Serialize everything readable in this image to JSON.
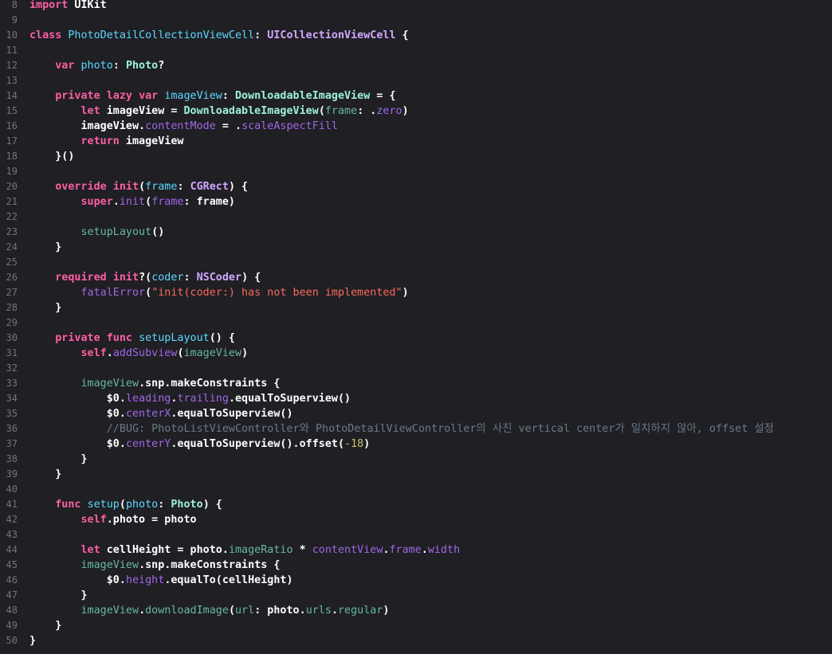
{
  "editor": {
    "language": "swift",
    "colors": {
      "background": "#1f1f24",
      "keyword": "#fc5fa3",
      "declaration": "#5dd8ff",
      "type": "#d0a8ff",
      "project_type": "#9ef1dd",
      "member": "#67b7a4",
      "other_property": "#a167e6",
      "string": "#fc6a5d",
      "number": "#d0bf69",
      "comment": "#6c7986",
      "line_number": "#747478"
    },
    "lines": [
      {
        "n": "8",
        "tokens": [
          {
            "t": "import",
            "c": "kw"
          },
          {
            "t": " UIKit",
            "c": "plain"
          }
        ]
      },
      {
        "n": "9",
        "tokens": []
      },
      {
        "n": "10",
        "tokens": [
          {
            "t": "class",
            "c": "kw"
          },
          {
            "t": " ",
            "c": "plain"
          },
          {
            "t": "PhotoDetailCollectionViewCell",
            "c": "decl"
          },
          {
            "t": ": ",
            "c": "plain"
          },
          {
            "t": "UICollectionViewCell",
            "c": "type"
          },
          {
            "t": " {",
            "c": "plain"
          }
        ]
      },
      {
        "n": "11",
        "tokens": []
      },
      {
        "n": "12",
        "tokens": [
          {
            "t": "    ",
            "c": "plain"
          },
          {
            "t": "var",
            "c": "kw"
          },
          {
            "t": " ",
            "c": "plain"
          },
          {
            "t": "photo",
            "c": "decl"
          },
          {
            "t": ": ",
            "c": "plain"
          },
          {
            "t": "Photo",
            "c": "tyof"
          },
          {
            "t": "?",
            "c": "plain"
          }
        ]
      },
      {
        "n": "13",
        "tokens": []
      },
      {
        "n": "14",
        "tokens": [
          {
            "t": "    ",
            "c": "plain"
          },
          {
            "t": "private",
            "c": "kw"
          },
          {
            "t": " ",
            "c": "plain"
          },
          {
            "t": "lazy",
            "c": "kw"
          },
          {
            "t": " ",
            "c": "plain"
          },
          {
            "t": "var",
            "c": "kw"
          },
          {
            "t": " ",
            "c": "plain"
          },
          {
            "t": "imageView",
            "c": "decl"
          },
          {
            "t": ": ",
            "c": "plain"
          },
          {
            "t": "DownloadableImageView",
            "c": "tyof"
          },
          {
            "t": " = {",
            "c": "plain"
          }
        ]
      },
      {
        "n": "15",
        "tokens": [
          {
            "t": "        ",
            "c": "plain"
          },
          {
            "t": "let",
            "c": "kw"
          },
          {
            "t": " imageView = ",
            "c": "plain"
          },
          {
            "t": "DownloadableImageView",
            "c": "tyof"
          },
          {
            "t": "(",
            "c": "plain"
          },
          {
            "t": "frame",
            "c": "memb"
          },
          {
            "t": ": .",
            "c": "plain"
          },
          {
            "t": "zero",
            "c": "prop"
          },
          {
            "t": ")",
            "c": "plain"
          }
        ]
      },
      {
        "n": "16",
        "tokens": [
          {
            "t": "        imageView.",
            "c": "plain"
          },
          {
            "t": "contentMode",
            "c": "prop"
          },
          {
            "t": " = .",
            "c": "plain"
          },
          {
            "t": "scaleAspectFill",
            "c": "prop"
          }
        ]
      },
      {
        "n": "17",
        "tokens": [
          {
            "t": "        ",
            "c": "plain"
          },
          {
            "t": "return",
            "c": "kw"
          },
          {
            "t": " imageView",
            "c": "plain"
          }
        ]
      },
      {
        "n": "18",
        "tokens": [
          {
            "t": "    }()",
            "c": "plain"
          }
        ]
      },
      {
        "n": "19",
        "tokens": []
      },
      {
        "n": "20",
        "tokens": [
          {
            "t": "    ",
            "c": "plain"
          },
          {
            "t": "override",
            "c": "kw"
          },
          {
            "t": " ",
            "c": "plain"
          },
          {
            "t": "init",
            "c": "kw"
          },
          {
            "t": "(",
            "c": "plain"
          },
          {
            "t": "frame",
            "c": "decl"
          },
          {
            "t": ": ",
            "c": "plain"
          },
          {
            "t": "CGRect",
            "c": "type"
          },
          {
            "t": ") {",
            "c": "plain"
          }
        ]
      },
      {
        "n": "21",
        "tokens": [
          {
            "t": "        ",
            "c": "plain"
          },
          {
            "t": "super",
            "c": "kw"
          },
          {
            "t": ".",
            "c": "plain"
          },
          {
            "t": "init",
            "c": "prop"
          },
          {
            "t": "(",
            "c": "plain"
          },
          {
            "t": "frame",
            "c": "prop"
          },
          {
            "t": ": frame)",
            "c": "plain"
          }
        ]
      },
      {
        "n": "22",
        "tokens": []
      },
      {
        "n": "23",
        "tokens": [
          {
            "t": "        ",
            "c": "plain"
          },
          {
            "t": "setupLayout",
            "c": "memb"
          },
          {
            "t": "()",
            "c": "plain"
          }
        ]
      },
      {
        "n": "24",
        "tokens": [
          {
            "t": "    }",
            "c": "plain"
          }
        ]
      },
      {
        "n": "25",
        "tokens": []
      },
      {
        "n": "26",
        "tokens": [
          {
            "t": "    ",
            "c": "plain"
          },
          {
            "t": "required",
            "c": "kw"
          },
          {
            "t": " ",
            "c": "plain"
          },
          {
            "t": "init",
            "c": "kw"
          },
          {
            "t": "?(",
            "c": "plain"
          },
          {
            "t": "coder",
            "c": "decl"
          },
          {
            "t": ": ",
            "c": "plain"
          },
          {
            "t": "NSCoder",
            "c": "type"
          },
          {
            "t": ") {",
            "c": "plain"
          }
        ]
      },
      {
        "n": "27",
        "tokens": [
          {
            "t": "        ",
            "c": "plain"
          },
          {
            "t": "fatalError",
            "c": "prop"
          },
          {
            "t": "(",
            "c": "plain"
          },
          {
            "t": "\"init(coder:) has not been implemented\"",
            "c": "str"
          },
          {
            "t": ")",
            "c": "plain"
          }
        ]
      },
      {
        "n": "28",
        "tokens": [
          {
            "t": "    }",
            "c": "plain"
          }
        ]
      },
      {
        "n": "29",
        "tokens": []
      },
      {
        "n": "30",
        "tokens": [
          {
            "t": "    ",
            "c": "plain"
          },
          {
            "t": "private",
            "c": "kw"
          },
          {
            "t": " ",
            "c": "plain"
          },
          {
            "t": "func",
            "c": "kw"
          },
          {
            "t": " ",
            "c": "plain"
          },
          {
            "t": "setupLayout",
            "c": "decl"
          },
          {
            "t": "() {",
            "c": "plain"
          }
        ]
      },
      {
        "n": "31",
        "tokens": [
          {
            "t": "        ",
            "c": "plain"
          },
          {
            "t": "self",
            "c": "kw"
          },
          {
            "t": ".",
            "c": "plain"
          },
          {
            "t": "addSubview",
            "c": "prop"
          },
          {
            "t": "(",
            "c": "plain"
          },
          {
            "t": "imageView",
            "c": "memb"
          },
          {
            "t": ")",
            "c": "plain"
          }
        ]
      },
      {
        "n": "32",
        "tokens": []
      },
      {
        "n": "33",
        "tokens": [
          {
            "t": "        ",
            "c": "plain"
          },
          {
            "t": "imageView",
            "c": "memb"
          },
          {
            "t": ".snp.makeConstraints {",
            "c": "plain"
          }
        ]
      },
      {
        "n": "34",
        "tokens": [
          {
            "t": "            $0.",
            "c": "plain"
          },
          {
            "t": "leading",
            "c": "prop"
          },
          {
            "t": ".",
            "c": "plain"
          },
          {
            "t": "trailing",
            "c": "prop"
          },
          {
            "t": ".equalToSuperview()",
            "c": "plain"
          }
        ]
      },
      {
        "n": "35",
        "tokens": [
          {
            "t": "            $0.",
            "c": "plain"
          },
          {
            "t": "centerX",
            "c": "prop"
          },
          {
            "t": ".equalToSuperview()",
            "c": "plain"
          }
        ]
      },
      {
        "n": "36",
        "tokens": [
          {
            "t": "            ",
            "c": "plain"
          },
          {
            "t": "//BUG: PhotoListViewController와 PhotoDetailViewController의 사진 vertical center가 일치하지 않아, offset 설정",
            "c": "cmt"
          }
        ]
      },
      {
        "n": "37",
        "tokens": [
          {
            "t": "            $0.",
            "c": "plain"
          },
          {
            "t": "centerY",
            "c": "prop"
          },
          {
            "t": ".equalToSuperview().offset(",
            "c": "plain"
          },
          {
            "t": "-18",
            "c": "num"
          },
          {
            "t": ")",
            "c": "plain"
          }
        ]
      },
      {
        "n": "38",
        "tokens": [
          {
            "t": "        }",
            "c": "plain"
          }
        ]
      },
      {
        "n": "39",
        "tokens": [
          {
            "t": "    }",
            "c": "plain"
          }
        ]
      },
      {
        "n": "40",
        "tokens": []
      },
      {
        "n": "41",
        "tokens": [
          {
            "t": "    ",
            "c": "plain"
          },
          {
            "t": "func",
            "c": "kw"
          },
          {
            "t": " ",
            "c": "plain"
          },
          {
            "t": "setup",
            "c": "decl"
          },
          {
            "t": "(",
            "c": "plain"
          },
          {
            "t": "photo",
            "c": "decl"
          },
          {
            "t": ": ",
            "c": "plain"
          },
          {
            "t": "Photo",
            "c": "tyof"
          },
          {
            "t": ") {",
            "c": "plain"
          }
        ]
      },
      {
        "n": "42",
        "tokens": [
          {
            "t": "        ",
            "c": "plain"
          },
          {
            "t": "self",
            "c": "kw"
          },
          {
            "t": ".photo = photo",
            "c": "plain"
          }
        ]
      },
      {
        "n": "43",
        "tokens": []
      },
      {
        "n": "44",
        "tokens": [
          {
            "t": "        ",
            "c": "plain"
          },
          {
            "t": "let",
            "c": "kw"
          },
          {
            "t": " cellHeight = photo.",
            "c": "plain"
          },
          {
            "t": "imageRatio",
            "c": "memb"
          },
          {
            "t": " * ",
            "c": "plain"
          },
          {
            "t": "contentView",
            "c": "prop"
          },
          {
            "t": ".",
            "c": "plain"
          },
          {
            "t": "frame",
            "c": "prop"
          },
          {
            "t": ".",
            "c": "plain"
          },
          {
            "t": "width",
            "c": "prop"
          }
        ]
      },
      {
        "n": "45",
        "tokens": [
          {
            "t": "        ",
            "c": "plain"
          },
          {
            "t": "imageView",
            "c": "memb"
          },
          {
            "t": ".snp.makeConstraints {",
            "c": "plain"
          }
        ]
      },
      {
        "n": "46",
        "tokens": [
          {
            "t": "            $0.",
            "c": "plain"
          },
          {
            "t": "height",
            "c": "prop"
          },
          {
            "t": ".equalTo(cellHeight)",
            "c": "plain"
          }
        ]
      },
      {
        "n": "47",
        "tokens": [
          {
            "t": "        }",
            "c": "plain"
          }
        ]
      },
      {
        "n": "48",
        "tokens": [
          {
            "t": "        ",
            "c": "plain"
          },
          {
            "t": "imageView",
            "c": "memb"
          },
          {
            "t": ".",
            "c": "plain"
          },
          {
            "t": "downloadImage",
            "c": "memb"
          },
          {
            "t": "(",
            "c": "plain"
          },
          {
            "t": "url",
            "c": "memb"
          },
          {
            "t": ": photo.",
            "c": "plain"
          },
          {
            "t": "urls",
            "c": "memb"
          },
          {
            "t": ".",
            "c": "plain"
          },
          {
            "t": "regular",
            "c": "memb"
          },
          {
            "t": ")",
            "c": "plain"
          }
        ]
      },
      {
        "n": "49",
        "tokens": [
          {
            "t": "    }",
            "c": "plain"
          }
        ]
      },
      {
        "n": "50",
        "tokens": [
          {
            "t": "}",
            "c": "plain"
          }
        ]
      }
    ]
  }
}
